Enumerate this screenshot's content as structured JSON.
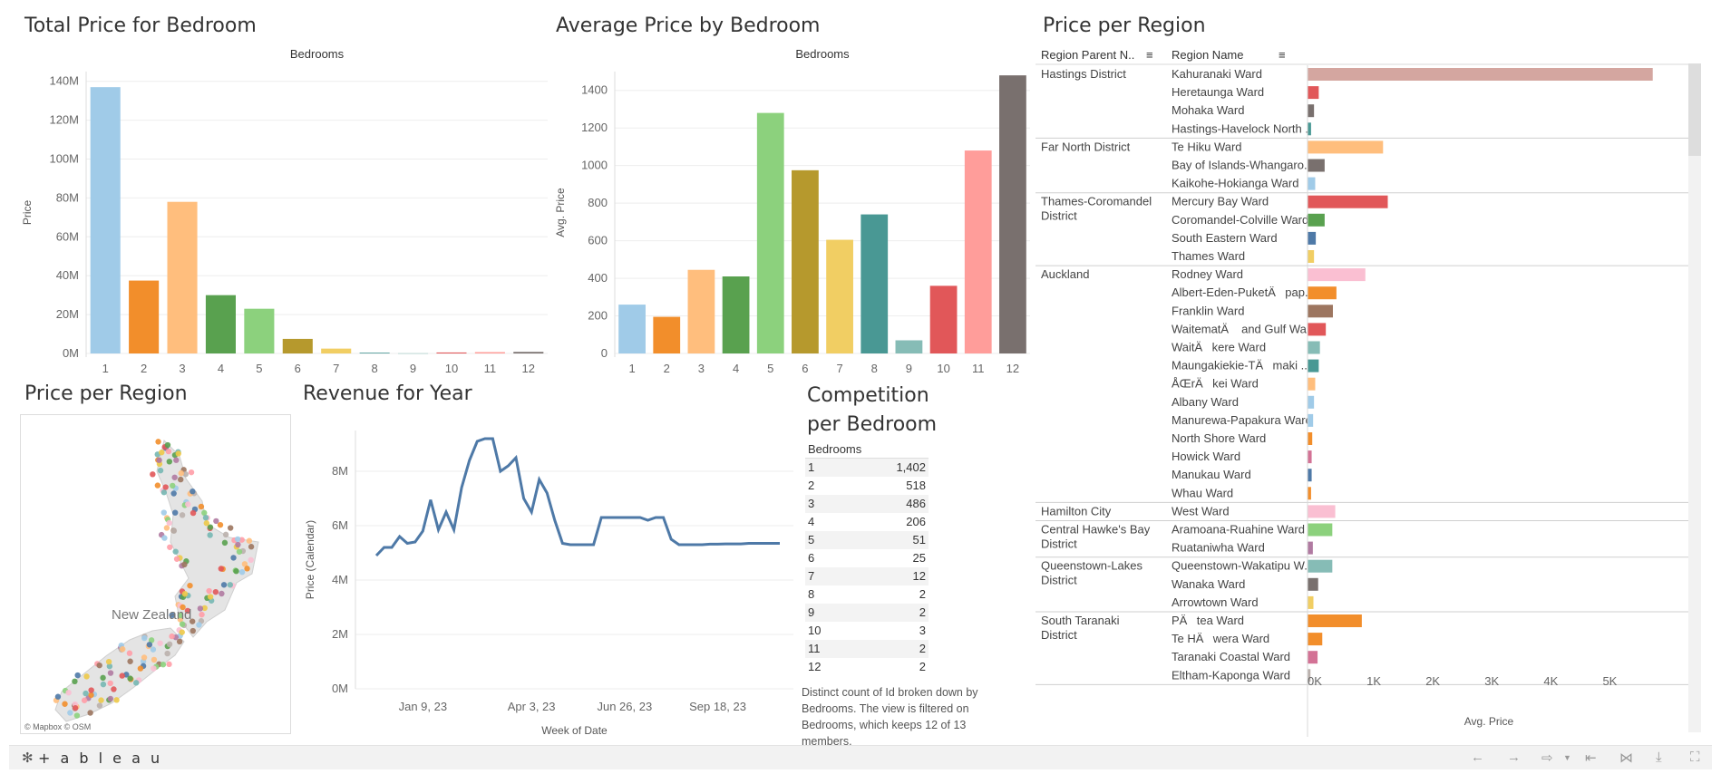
{
  "titles": {
    "total_price": "Total Price for Bedroom",
    "avg_price": "Average Price by Bedroom",
    "region_table": "Price per Region",
    "map": "Price per Region",
    "revenue": "Revenue for Year",
    "competition_line1": "Competition",
    "competition_line2": "per Bedroom"
  },
  "chart_data": [
    {
      "type": "bar",
      "title": "Total Price for Bedroom",
      "header": "Bedrooms",
      "ylabel": "Price",
      "categories": [
        "1",
        "2",
        "3",
        "4",
        "5",
        "6",
        "7",
        "8",
        "9",
        "10",
        "11",
        "12"
      ],
      "values": [
        137000000,
        37500000,
        78000000,
        30000000,
        23000000,
        7500000,
        2500000,
        400000,
        100000,
        500000,
        700000,
        800000
      ],
      "ylim": [
        0,
        145000000
      ],
      "yticks": [
        0,
        20000000,
        40000000,
        60000000,
        80000000,
        100000000,
        120000000,
        140000000
      ],
      "ytick_labels": [
        "0M",
        "20M",
        "40M",
        "60M",
        "80M",
        "100M",
        "120M",
        "140M"
      ],
      "colors": [
        "#a0cbe8",
        "#f28e2b",
        "#ffbe7d",
        "#59a14f",
        "#8cd17d",
        "#b6992d",
        "#f1ce63",
        "#499894",
        "#86bcb6",
        "#e15759",
        "#ff9d9a",
        "#79706e"
      ]
    },
    {
      "type": "bar",
      "title": "Average Price by Bedroom",
      "header": "Bedrooms",
      "ylabel": "Avg. Price",
      "categories": [
        "1",
        "2",
        "3",
        "4",
        "5",
        "6",
        "7",
        "8",
        "9",
        "10",
        "11",
        "12"
      ],
      "values": [
        260,
        195,
        445,
        410,
        1280,
        975,
        605,
        740,
        70,
        360,
        1080,
        1480
      ],
      "ylim": [
        0,
        1500
      ],
      "yticks": [
        0,
        200,
        400,
        600,
        800,
        1000,
        1200,
        1400
      ],
      "ytick_labels": [
        "0",
        "200",
        "400",
        "600",
        "800",
        "1000",
        "1200",
        "1400"
      ],
      "colors": [
        "#a0cbe8",
        "#f28e2b",
        "#ffbe7d",
        "#59a14f",
        "#8cd17d",
        "#b6992d",
        "#f1ce63",
        "#499894",
        "#86bcb6",
        "#e15759",
        "#ff9d9a",
        "#79706e"
      ]
    },
    {
      "type": "line",
      "title": "Revenue for Year",
      "xlabel": "Week of Date",
      "ylabel": "Price (Calendar)",
      "x_ticks": [
        "Jan 9, 23",
        "Apr 3, 23",
        "Jun 26, 23",
        "Sep 18, 23"
      ],
      "ylim": [
        0,
        9500000
      ],
      "yticks": [
        0,
        2000000,
        4000000,
        6000000,
        8000000
      ],
      "ytick_labels": [
        "0M",
        "2M",
        "4M",
        "6M",
        "8M"
      ],
      "color": "#4e79a7",
      "week_offsets": [
        0,
        1,
        2,
        3,
        4,
        5,
        6,
        7,
        8,
        9,
        10,
        11,
        12,
        13,
        14,
        15,
        16,
        17,
        18,
        19,
        20,
        21,
        22,
        23,
        24,
        25,
        26,
        27,
        28,
        29,
        30,
        31,
        32,
        33,
        34,
        35,
        36,
        37,
        38,
        39,
        40,
        41,
        42,
        43,
        44,
        45,
        46,
        47,
        48,
        49,
        50,
        51,
        52
      ],
      "values": [
        4900000,
        5200000,
        5200000,
        5600000,
        5350000,
        5400000,
        5800000,
        6950000,
        5850000,
        6500000,
        5850000,
        7400000,
        8400000,
        9100000,
        9200000,
        9200000,
        8000000,
        8200000,
        8500000,
        7000000,
        6500000,
        7700000,
        7200000,
        6200000,
        5350000,
        5300000,
        5300000,
        5300000,
        5300000,
        6300000,
        6300000,
        6300000,
        6300000,
        6300000,
        6300000,
        6200000,
        6300000,
        6300000,
        5500000,
        5300000,
        5300000,
        5300000,
        5300000,
        5320000,
        5320000,
        5330000,
        5330000,
        5330000,
        5350000,
        5350000,
        5350000,
        5350000,
        5350000
      ]
    }
  ],
  "competition": {
    "header": "Bedrooms",
    "rows": [
      {
        "bedrooms": "1",
        "count": "1,402"
      },
      {
        "bedrooms": "2",
        "count": "518"
      },
      {
        "bedrooms": "3",
        "count": "486"
      },
      {
        "bedrooms": "4",
        "count": "206"
      },
      {
        "bedrooms": "5",
        "count": "51"
      },
      {
        "bedrooms": "6",
        "count": "25"
      },
      {
        "bedrooms": "7",
        "count": "12"
      },
      {
        "bedrooms": "8",
        "count": "2"
      },
      {
        "bedrooms": "9",
        "count": "2"
      },
      {
        "bedrooms": "10",
        "count": "3"
      },
      {
        "bedrooms": "11",
        "count": "2"
      },
      {
        "bedrooms": "12",
        "count": "2"
      }
    ],
    "caption": "Distinct count of Id broken down by Bedrooms. The view is filtered on Bedrooms, which keeps 12 of 13 members."
  },
  "region_table": {
    "col1_header": "Region Parent N..",
    "col2_header": "Region Name",
    "axis_title": "Avg. Price",
    "axis_ticks": [
      "0K",
      "1K",
      "2K",
      "3K",
      "4K",
      "5K"
    ],
    "axis_max": 6300,
    "groups": [
      {
        "parent": "Hastings District",
        "rows": [
          {
            "name": "Kahuranaki Ward",
            "value": 5850,
            "color": "#d4a6a0"
          },
          {
            "name": "Heretaunga Ward",
            "value": 190,
            "color": "#e15759"
          },
          {
            "name": "Mohaka Ward",
            "value": 110,
            "color": "#79706e"
          },
          {
            "name": "Hastings-Havelock North ..",
            "value": 60,
            "color": "#499894"
          }
        ]
      },
      {
        "parent": "Far North District",
        "rows": [
          {
            "name": "Te Hiku Ward",
            "value": 1280,
            "color": "#ffbe7d"
          },
          {
            "name": "Bay of Islands-Whangaro..",
            "value": 290,
            "color": "#79706e"
          },
          {
            "name": "Kaikohe-Hokianga Ward",
            "value": 130,
            "color": "#a0cbe8"
          }
        ]
      },
      {
        "parent": "Thames-Coromandel District",
        "rows": [
          {
            "name": "Mercury Bay Ward",
            "value": 1360,
            "color": "#e15759"
          },
          {
            "name": "Coromandel-Colville Ward",
            "value": 290,
            "color": "#59a14f"
          },
          {
            "name": "South Eastern Ward",
            "value": 140,
            "color": "#4e79a7"
          },
          {
            "name": "Thames Ward",
            "value": 110,
            "color": "#f1ce63"
          }
        ]
      },
      {
        "parent": "Auckland",
        "rows": [
          {
            "name": "Rodney Ward",
            "value": 980,
            "color": "#fabfd2"
          },
          {
            "name": "Albert-Eden-PuketÄpap..",
            "value": 490,
            "color": "#f28e2b"
          },
          {
            "name": "Franklin Ward",
            "value": 430,
            "color": "#9d7660"
          },
          {
            "name": "WaitematÄ and Gulf Wa..",
            "value": 310,
            "color": "#e15759"
          },
          {
            "name": "WaitÄkere Ward",
            "value": 210,
            "color": "#86bcb6"
          },
          {
            "name": "Maungakiekie-TÄmaki ..",
            "value": 190,
            "color": "#499894"
          },
          {
            "name": "ÅŒrÄkei Ward",
            "value": 130,
            "color": "#ffbe7d"
          },
          {
            "name": "Albany Ward",
            "value": 110,
            "color": "#a0cbe8"
          },
          {
            "name": "Manurewa-Papakura Ward",
            "value": 95,
            "color": "#a0cbe8"
          },
          {
            "name": "North Shore Ward",
            "value": 80,
            "color": "#f28e2b"
          },
          {
            "name": "Howick Ward",
            "value": 70,
            "color": "#d37295"
          },
          {
            "name": "Manukau Ward",
            "value": 70,
            "color": "#4e79a7"
          },
          {
            "name": "Whau Ward",
            "value": 60,
            "color": "#f28e2b"
          }
        ]
      },
      {
        "parent": "Hamilton City",
        "rows": [
          {
            "name": "West Ward",
            "value": 470,
            "color": "#fabfd2"
          }
        ]
      },
      {
        "parent": "Central Hawke's Bay District",
        "rows": [
          {
            "name": "Aramoana-Ruahine Ward",
            "value": 420,
            "color": "#8cd17d"
          },
          {
            "name": "Ruataniwha Ward",
            "value": 90,
            "color": "#b07aa1"
          }
        ]
      },
      {
        "parent": "Queenstown-Lakes District",
        "rows": [
          {
            "name": "Queenstown-Wakatipu W..",
            "value": 420,
            "color": "#86bcb6"
          },
          {
            "name": "Wanaka Ward",
            "value": 180,
            "color": "#79706e"
          },
          {
            "name": "Arrowtown Ward",
            "value": 100,
            "color": "#f1ce63"
          }
        ]
      },
      {
        "parent": "South Taranaki District",
        "rows": [
          {
            "name": "PÄtea Ward",
            "value": 920,
            "color": "#f28e2b"
          },
          {
            "name": "Te HÄwera Ward",
            "value": 250,
            "color": "#f28e2b"
          },
          {
            "name": "Taranaki Coastal Ward",
            "value": 170,
            "color": "#d37295"
          },
          {
            "name": "Eltham-Kaponga Ward",
            "value": 50,
            "color": "#bab0ac"
          }
        ]
      }
    ]
  },
  "map": {
    "label": "New Zealand",
    "credit": "© Mapbox  © OSM"
  },
  "footer": {
    "brand": "+ a b l e a u"
  }
}
